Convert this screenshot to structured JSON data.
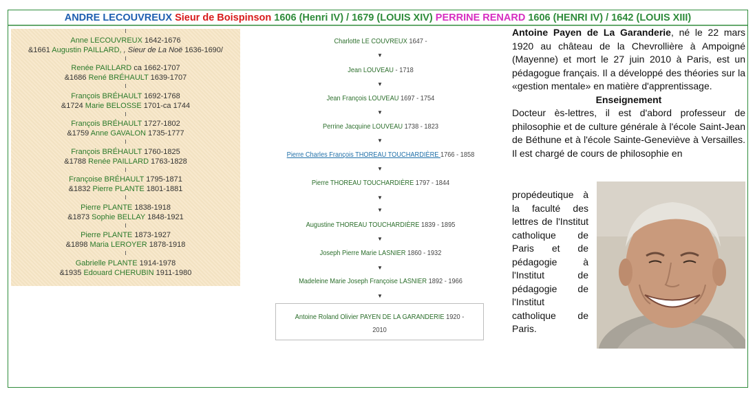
{
  "title": {
    "part1": "ANDRE LECOUVREUX ",
    "part2": "Sieur de Boispinson ",
    "part3": "1606 (Henri IV) / 1679 (LOUIS XIV) ",
    "part4": "PERRINE RENARD ",
    "part5": "1606 (HENRI IV) / 1642 (LOUIS XIII)"
  },
  "colors": {
    "blue": "#1f5fb0",
    "red": "#d81b1b",
    "green": "#2e8b3a",
    "magenta": "#d62ec0"
  },
  "left": [
    {
      "name": "Anne LECOUVREUX",
      "dates": "1642-1676",
      "spouse_prefix": "&1661",
      "spouse": "Augustin PAILLARD,",
      "sieur": " , Sieur de La Noë",
      "spouse_dates": "1636-1690/"
    },
    {
      "name": "Renée PAILLARD",
      "dates": "ca 1662-1707",
      "spouse_prefix": "&1686",
      "spouse": "René BRÉHAULT",
      "spouse_dates": "1639-1707"
    },
    {
      "name": "François BRÉHAULT",
      "dates": "1692-1768",
      "spouse_prefix": "&1724",
      "spouse": "Marie BELOSSE",
      "spouse_dates": "1701-ca 1744"
    },
    {
      "name": "François BRÉHAULT",
      "dates": "1727-1802",
      "spouse_prefix": "&1759",
      "spouse": "Anne GAVALON",
      "spouse_dates": "1735-1777"
    },
    {
      "name": "François BRÉHAULT",
      "dates": "1760-1825",
      "spouse_prefix": "&1788",
      "spouse": "Renée PAILLARD",
      "spouse_dates": "1763-1828"
    },
    {
      "name": "Françoise BRÉHAULT",
      "dates": "1795-1871",
      "spouse_prefix": "&1832",
      "spouse": "Pierre PLANTE",
      "spouse_dates": "1801-1881"
    },
    {
      "name": "Pierre PLANTE",
      "dates": "1838-1918",
      "spouse_prefix": "&1873",
      "spouse": "Sophie BELLAY",
      "spouse_dates": "1848-1921"
    },
    {
      "name": "Pierre PLANTE",
      "dates": "1873-1927",
      "spouse_prefix": "&1898",
      "spouse": "Maria LEROYER",
      "spouse_dates": "1878-1918"
    },
    {
      "name": "Gabrielle PLANTE",
      "dates": "1914-1978",
      "spouse_prefix": "&1935",
      "spouse": "Edouard CHERUBIN",
      "spouse_dates": "1911-1980"
    }
  ],
  "middle": [
    {
      "name": "Charlotte LE COUVREUX",
      "dates": "1647 -"
    },
    {
      "name": "Jean LOUVEAU",
      "dates": "- 1718"
    },
    {
      "name": "Jean François LOUVEAU",
      "dates": "1697 - 1754"
    },
    {
      "name": "Perrine Jacquine LOUVEAU",
      "dates": "1738 - 1823"
    },
    {
      "name": "Pierre Charles François THOREAU TOUCHARDIÈRE ",
      "dates": "1766 - 1858"
    },
    {
      "name": "Pierre THOREAU TOUCHARDIÈRE",
      "dates": "1797 - 1844"
    },
    {
      "name": "Augustine THOREAU TOUCHARDIÈRE",
      "dates": "1839 - 1895"
    },
    {
      "name": "Joseph Pierre Marie LASNIER",
      "dates": "1860 - 1932"
    },
    {
      "name": "Madeleine Marie Joseph Françoise LASNIER",
      "dates": "1892 - 1966"
    }
  ],
  "final": {
    "name": "Antoine Roland Olivier PAYEN DE LA GARANDERIE",
    "dates_a": "1920 -",
    "dates_b": "2010"
  },
  "bio": {
    "name": "Antoine Payen de La Garanderie",
    "intro": ", né le 22 mars 1920 au château de la Chevrollière à Ampoigné (Mayenne) et mort le 27 juin 2010 à Paris, est un pédagogue français. Il a développé des théories sur la «gestion mentale» en matière d'apprentissage.",
    "heading": "Enseignement",
    "para2": "Docteur ès-lettres, il est d'abord professeur de philosophie et de culture générale à l'école Saint-Jean de Béthune et à l'école Sainte-Geneviève à Versailles. Il est chargé de cours de philosophie en",
    "narrow": "propédeutique à la faculté des lettres de l'Institut catholique de Paris et de pédagogie à l'Institut de pédagogie de l'Institut catholique de Paris."
  }
}
